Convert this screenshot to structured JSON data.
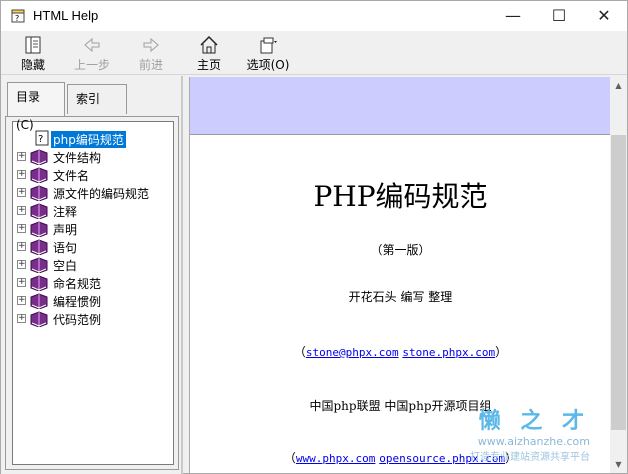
{
  "window": {
    "title": "HTML Help",
    "minimize": "—",
    "maximize": "☐",
    "close": "✕"
  },
  "toolbar": {
    "hide": "隐藏",
    "back": "上一步",
    "forward": "前进",
    "home": "主页",
    "options": "选项(O)"
  },
  "tabs": {
    "contents": "目录(C)",
    "index": "索引(N)"
  },
  "tree": {
    "selected": "php编码规范",
    "items": [
      "文件结构",
      "文件名",
      "源文件的编码规范",
      "注释",
      "声明",
      "语句",
      "空白",
      "命名规范",
      "编程惯例",
      "代码范例"
    ]
  },
  "doc": {
    "title": "PHP编码规范",
    "edition": "（第一版）",
    "authors": "开花石头  编写  整理",
    "contact_open": "（",
    "email": "stone@phpx.com",
    "site": "stone.phpx.com",
    "contact_close": "）",
    "orgs": "中国php联盟  中国php开源项目组",
    "footer_open": "（",
    "footer_site1": "www.phpx.com",
    "footer_site2": "opensource.phpx.com",
    "footer_close": "）"
  },
  "watermark": {
    "brand": "懒 之 才",
    "url": "www.aizhanzhe.com",
    "slogan": "打造专业建站资源共享平台"
  },
  "colors": {
    "banner": "#ccccff",
    "selection": "#0078d7",
    "book": "#7b2d8e"
  }
}
